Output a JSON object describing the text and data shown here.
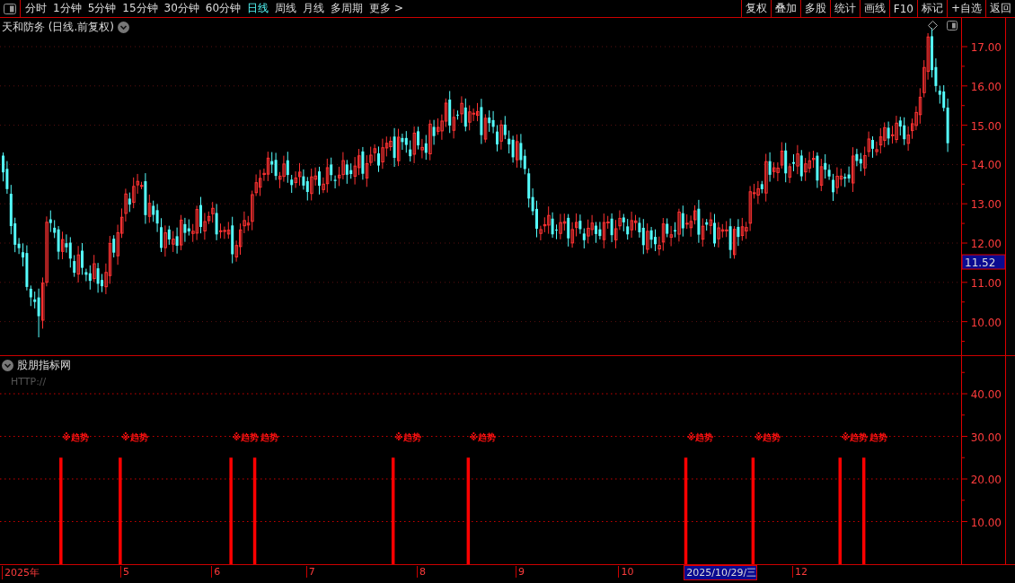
{
  "toolbar": {
    "tabs": [
      {
        "label": "分时",
        "selected": false
      },
      {
        "label": "1分钟",
        "selected": false
      },
      {
        "label": "5分钟",
        "selected": false
      },
      {
        "label": "15分钟",
        "selected": false
      },
      {
        "label": "30分钟",
        "selected": false
      },
      {
        "label": "60分钟",
        "selected": false
      },
      {
        "label": "日线",
        "selected": true
      },
      {
        "label": "周线",
        "selected": false
      },
      {
        "label": "月线",
        "selected": false
      },
      {
        "label": "多周期",
        "selected": false
      },
      {
        "label": "更多 >",
        "selected": false
      }
    ],
    "buttons": [
      "复权",
      "叠加",
      "多股",
      "统计",
      "画线",
      "F10",
      "标记",
      "+自选",
      "返回"
    ]
  },
  "price_panel": {
    "title": "天和防务 (日线.前复权)",
    "yticks": [
      "17.00",
      "16.00",
      "15.00",
      "14.00",
      "13.00",
      "12.00",
      "11.00",
      "10.00"
    ],
    "current_price": "11.52"
  },
  "indicator_panel": {
    "title": "股朋指标网",
    "subtitle": "HTTP://",
    "yticks": [
      "40.00",
      "30.00",
      "20.00",
      "10.00"
    ],
    "signals": [
      {
        "label": "※趋势"
      },
      {
        "label": "※趋势"
      },
      {
        "label": "※趋势"
      },
      {
        "label": "趋势"
      },
      {
        "label": "※趋势"
      },
      {
        "label": "※趋势"
      },
      {
        "label": "※趋势"
      },
      {
        "label": "※趋势"
      },
      {
        "label": "※趋势"
      },
      {
        "label": "趋势"
      }
    ]
  },
  "date_axis": {
    "labels": [
      "2025年",
      "5",
      "6",
      "7",
      "8",
      "9",
      "10",
      "12"
    ],
    "cursor": "2025/10/29/三"
  }
}
